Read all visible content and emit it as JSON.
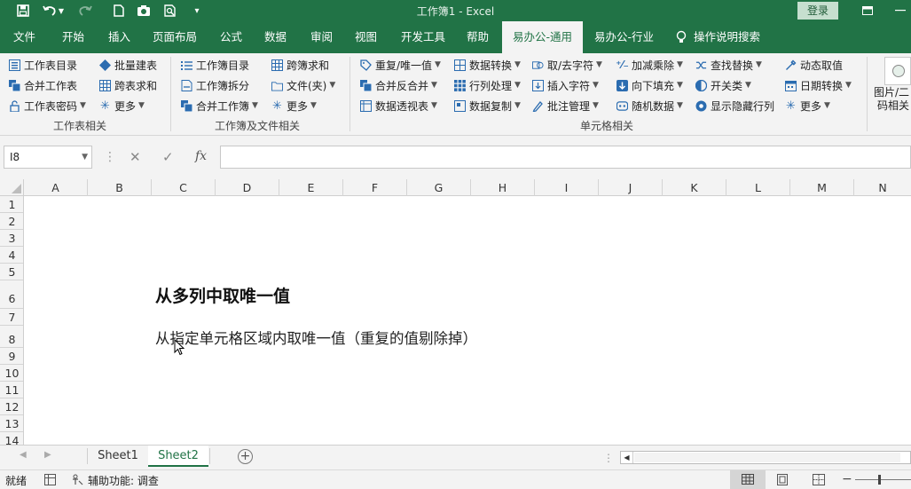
{
  "title_bar": {
    "title": "工作簿1  -  Excel",
    "login_label": "登录"
  },
  "tabs": [
    "文件",
    "开始",
    "插入",
    "页面布局",
    "公式",
    "数据",
    "审阅",
    "视图",
    "开发工具",
    "帮助",
    "易办公-通用",
    "易办公-行业"
  ],
  "tell_me": "操作说明搜索",
  "ribbon": {
    "group1": {
      "label": "工作表相关",
      "items": [
        "工作表目录",
        "合并工作表",
        "工作表密码",
        "批量建表",
        "跨表求和",
        "更多"
      ]
    },
    "group2": {
      "label": "工作簿及文件相关",
      "items": [
        "工作簿目录",
        "工作簿拆分",
        "合并工作簿",
        "跨簿求和",
        "文件(夹)",
        "更多"
      ]
    },
    "group3": {
      "label": "单元格相关",
      "items": [
        "重复/唯一值",
        "合并反合并",
        "数据透视表",
        "数据转换",
        "行列处理",
        "数据复制",
        "取/去字符",
        "插入字符",
        "批注管理",
        "加减乘除",
        "向下填充",
        "随机数据",
        "查找替换",
        "开关类",
        "显示隐藏行列",
        "动态取值",
        "日期转换",
        "更多"
      ]
    },
    "group4": {
      "label_line1": "图片/二",
      "label_line2": "码相关"
    }
  },
  "formula_bar": {
    "name_box": "I8",
    "fx": "fx",
    "formula": ""
  },
  "columns": [
    "A",
    "B",
    "C",
    "D",
    "E",
    "F",
    "G",
    "H",
    "I",
    "J",
    "K",
    "L",
    "M",
    "N"
  ],
  "rows": [
    "1",
    "2",
    "3",
    "4",
    "5",
    "6",
    "7",
    "8",
    "9",
    "10",
    "11",
    "12",
    "13",
    "14"
  ],
  "cells": {
    "heading": "从多列中取唯一值",
    "subtext": "从指定单元格区域内取唯一值（重复的值剔除掉）"
  },
  "sheets": [
    "Sheet1",
    "Sheet2"
  ],
  "active_sheet": "Sheet2",
  "status": {
    "ready": "就绪",
    "accessibility": "辅助功能: 调查"
  },
  "colors": {
    "accent": "#217346",
    "sheet_tab_active": "#217346"
  }
}
